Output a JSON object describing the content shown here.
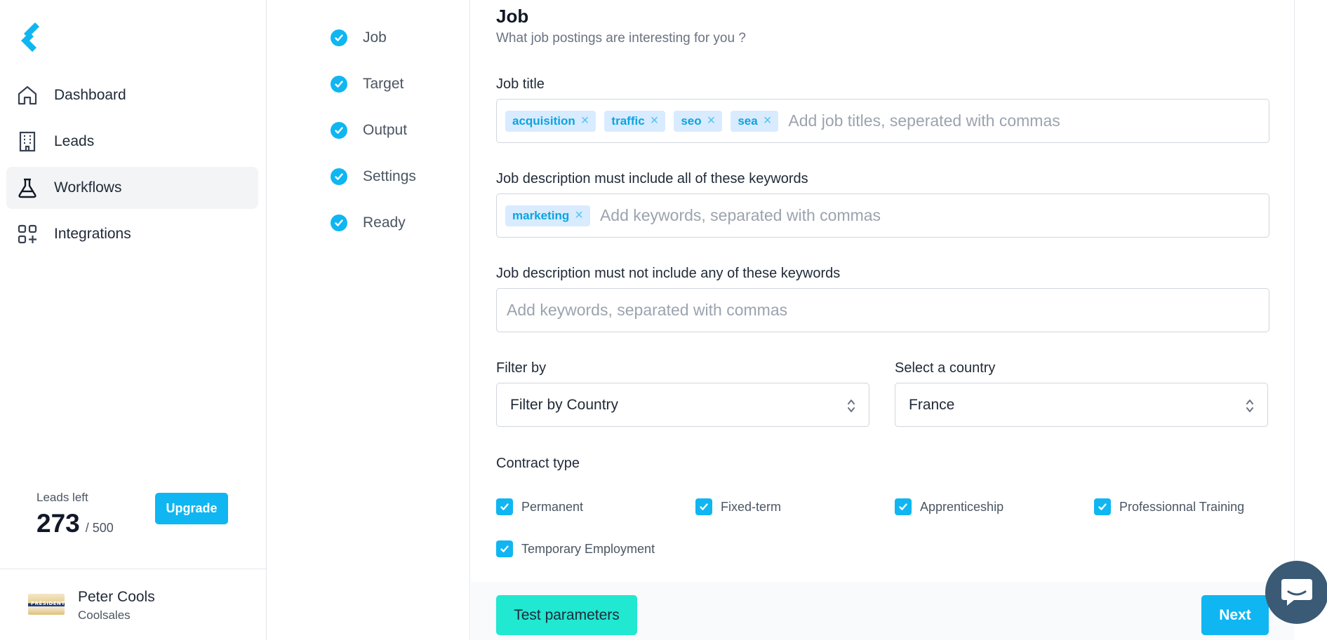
{
  "brand": {
    "accent": "#0fb6f2",
    "logo_icon": "chevron-logo-icon"
  },
  "sidebar": {
    "items": [
      {
        "label": "Dashboard",
        "icon": "home-icon"
      },
      {
        "label": "Leads",
        "icon": "building-icon"
      },
      {
        "label": "Workflows",
        "icon": "flask-icon",
        "active": true
      },
      {
        "label": "Integrations",
        "icon": "apps-add-icon"
      }
    ],
    "leads": {
      "caption": "Leads left",
      "remaining": "273",
      "total": "/ 500"
    },
    "upgrade_label": "Upgrade",
    "user": {
      "name": "Peter Cools",
      "company": "Coolsales",
      "avatar_text": "PRÉSIDENT"
    }
  },
  "steps": [
    {
      "label": "Job",
      "done": true
    },
    {
      "label": "Target",
      "done": true
    },
    {
      "label": "Output",
      "done": true
    },
    {
      "label": "Settings",
      "done": true
    },
    {
      "label": "Ready",
      "done": true
    }
  ],
  "form": {
    "title": "Job",
    "subtitle": "What job postings are interesting for you ?",
    "job_title": {
      "label": "Job title",
      "tags": [
        "acquisition",
        "traffic",
        "seo",
        "sea"
      ],
      "placeholder": "Add job titles, seperated with commas"
    },
    "include_keywords": {
      "label": "Job description must include all of these keywords",
      "tags": [
        "marketing"
      ],
      "placeholder": "Add keywords, separated with commas"
    },
    "exclude_keywords": {
      "label": "Job description must not include any of these keywords",
      "placeholder": "Add keywords, separated with commas"
    },
    "filter_by": {
      "label": "Filter by",
      "value": "Filter by Country"
    },
    "country": {
      "label": "Select a country",
      "value": "France"
    },
    "contract": {
      "label": "Contract type",
      "options": [
        {
          "label": "Permanent",
          "checked": true
        },
        {
          "label": "Fixed-term",
          "checked": true
        },
        {
          "label": "Apprenticeship",
          "checked": true
        },
        {
          "label": "Professionnal Training",
          "checked": true
        },
        {
          "label": "Temporary Employment",
          "checked": true
        }
      ]
    }
  },
  "footer": {
    "test_label": "Test parameters",
    "next_label": "Next"
  },
  "chat": {
    "icon": "chat-bubble-icon"
  }
}
